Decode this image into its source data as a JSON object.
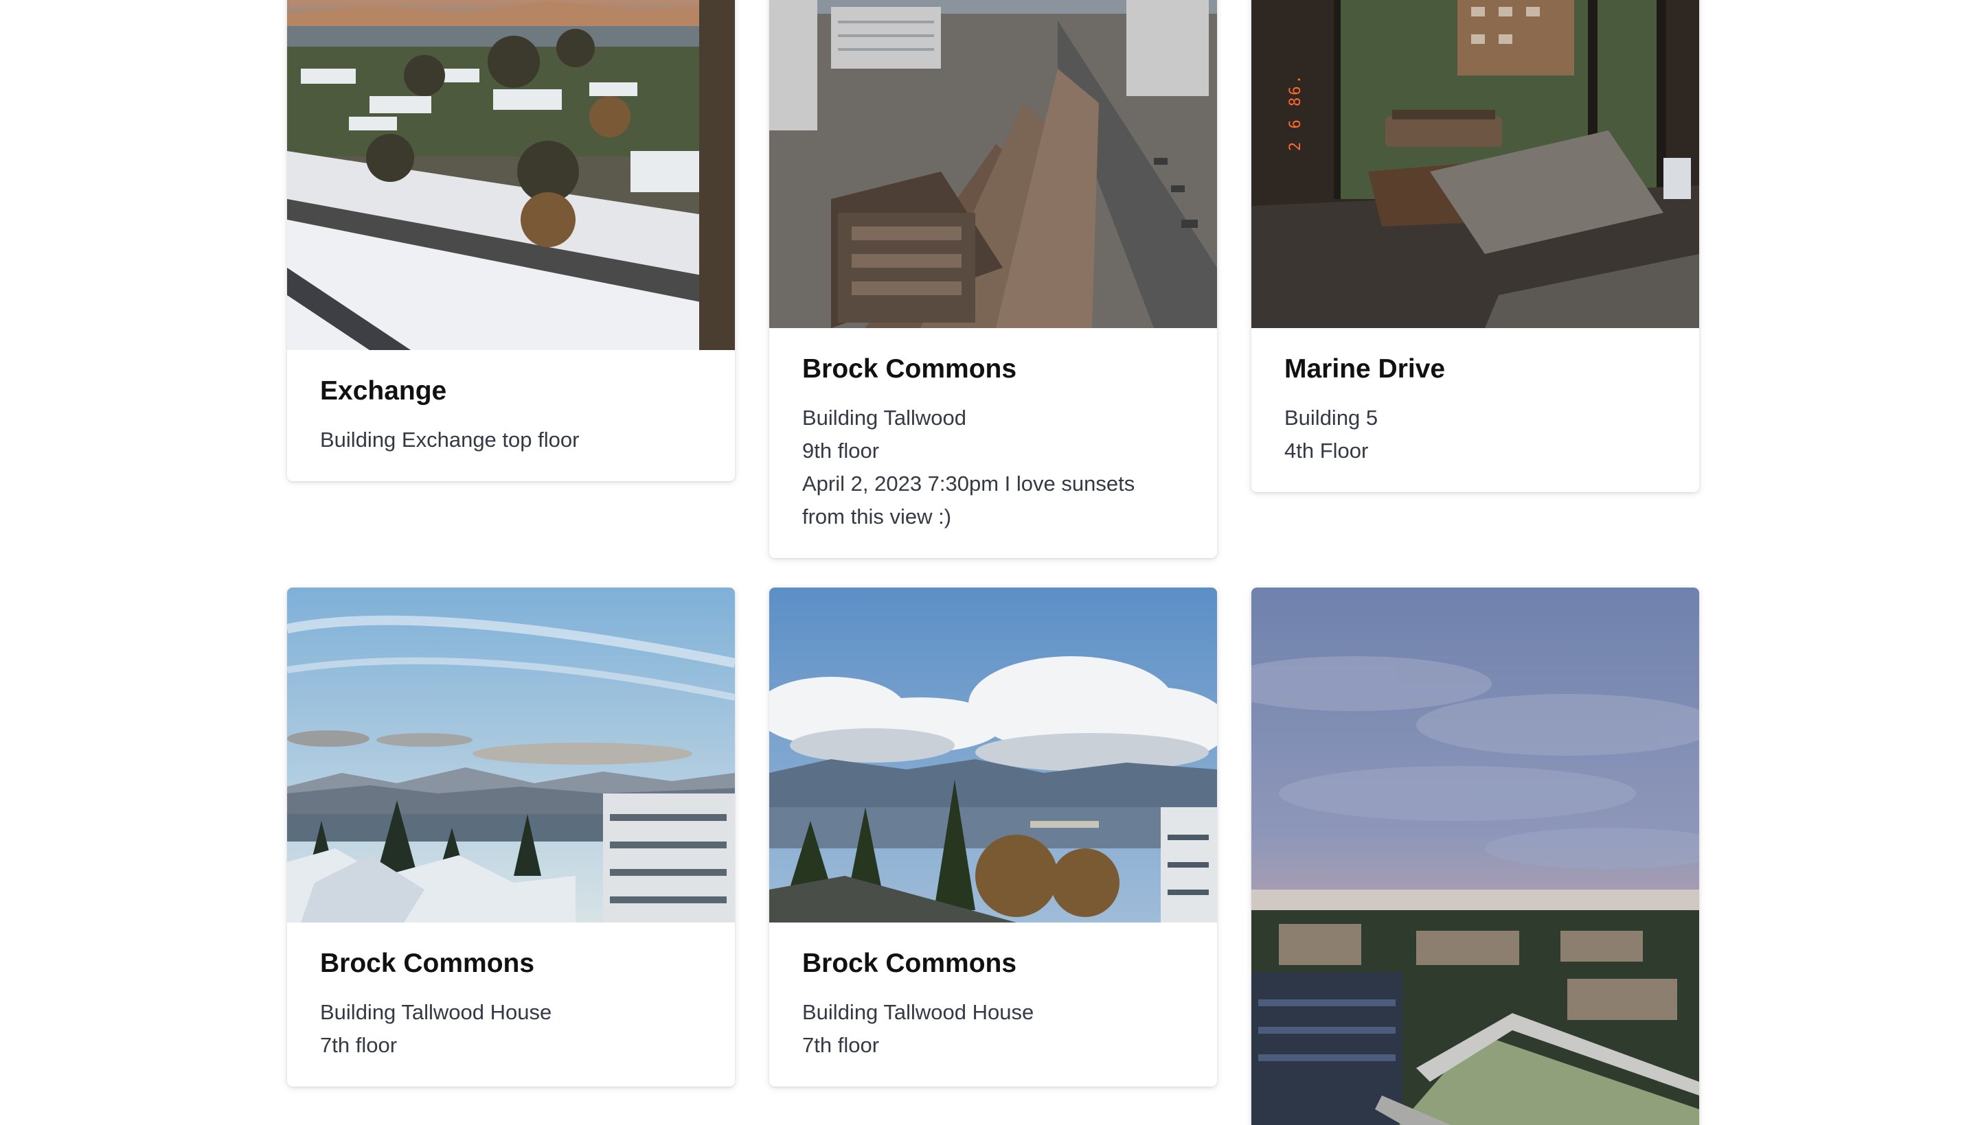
{
  "cards": [
    {
      "title": "Exchange",
      "lines": [
        "Building Exchange top floor"
      ],
      "photo": "snowy-neighborhood-view-photo"
    },
    {
      "title": "Brock Commons",
      "lines": [
        "Building Tallwood",
        "9th floor",
        "April 2, 2023 7:30pm I love sunsets",
        "from this view :)"
      ],
      "photo": "rooftops-street-view-photo"
    },
    {
      "title": "Marine Drive",
      "lines": [
        "Building 5",
        "4th Floor"
      ],
      "photo": "window-tray-interior-photo",
      "photo_stamp": "2 6 86."
    },
    {
      "title": "Brock Commons",
      "lines": [
        "Building Tallwood House",
        "7th floor"
      ],
      "photo": "snowy-mountains-view-photo"
    },
    {
      "title": "Brock Commons",
      "lines": [
        "Building Tallwood House",
        "7th floor"
      ],
      "photo": "clouds-mountains-view-photo"
    },
    {
      "photo": "sunset-campus-view-photo"
    }
  ],
  "colors": {
    "title": "#111111",
    "text": "#333a45",
    "stamp": "#ff6a2a"
  }
}
